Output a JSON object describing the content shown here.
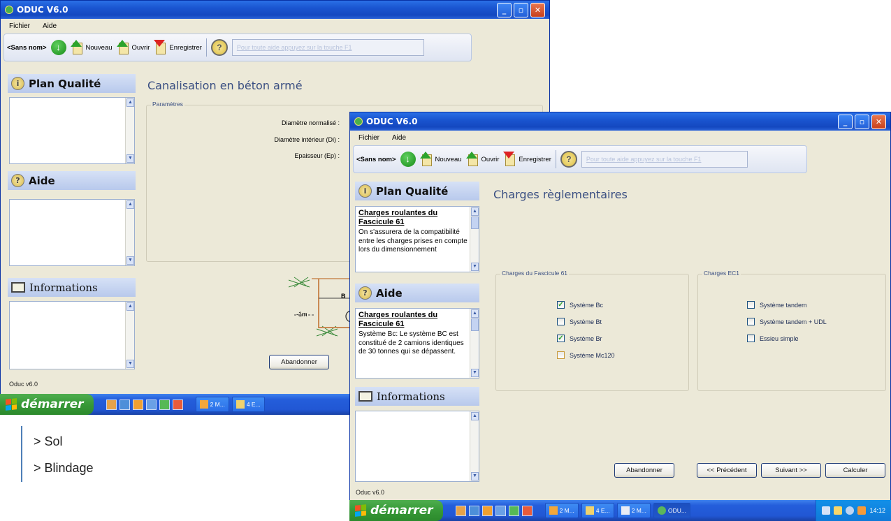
{
  "app": {
    "title": "ODUC V6.0",
    "menu": [
      "Fichier",
      "Aide"
    ],
    "doc_name": "<Sans nom>",
    "toolbar": {
      "new": "Nouveau",
      "open": "Ouvrir",
      "save": "Enregistrer"
    },
    "hint": "Pour toute aide appuyez sur la touche F1",
    "status": "Oduc v6.0",
    "window_buttons": [
      "_",
      "▫",
      "✕"
    ]
  },
  "back_window": {
    "panels": {
      "plan": "Plan Qualité",
      "aide": "Aide",
      "info": "Informations"
    },
    "section_title": "Canalisation en béton armé",
    "group_label": "Paramètres",
    "fields": [
      "Diamètre normalisé :",
      "Diamètre intérieur (Di) :",
      "Epaisseur (Ep) :"
    ],
    "diagram": {
      "depth_label": "-1m",
      "width_label": "B"
    },
    "abandon_label": "Abandonner"
  },
  "front_window": {
    "panels": {
      "plan": "Plan Qualité",
      "plan_title": "Charges roulantes du Fascicule 61",
      "plan_text": "On s'assurera de la compatibilité entre les charges prises en compte lors du dimensionnement",
      "aide": "Aide",
      "aide_title": "Charges roulantes du Fascicule 61",
      "aide_text": "Système Bc: Le système BC est constitué de 2 camions identiques de 30 tonnes qui se dépassent.",
      "info": "Informations"
    },
    "section_title": "Charges règlementaires",
    "group_fasc": {
      "label": "Charges du Fascicule 61",
      "options": [
        {
          "label": "Système Bc",
          "checked": true
        },
        {
          "label": "Système Bt",
          "checked": false
        },
        {
          "label": "Système Br",
          "checked": true
        },
        {
          "label": "Système Mc120",
          "checked": false
        }
      ]
    },
    "group_ec1": {
      "label": "Charges EC1",
      "options": [
        {
          "label": "Système tandem",
          "checked": false
        },
        {
          "label": "Système tandem + UDL",
          "checked": false
        },
        {
          "label": "Essieu simple",
          "checked": false
        }
      ]
    },
    "buttons": {
      "abandon": "Abandonner",
      "prev": "<< Précédent",
      "next": "Suivant >>",
      "calc": "Calculer"
    }
  },
  "taskbar": {
    "start": "démarrer",
    "tasks_back": [
      "2 M...",
      "4 E..."
    ],
    "tasks_front": [
      "2 M...",
      "4 E...",
      "2 M...",
      "ODU..."
    ],
    "clock": "14:12"
  },
  "page_text": [
    "> Sol",
    "> Blindage"
  ],
  "colors": {
    "title_blue": "#1a55d0",
    "taskbar_blue": "#245edb",
    "start_green": "#379937",
    "section_text": "#3a4f82"
  }
}
